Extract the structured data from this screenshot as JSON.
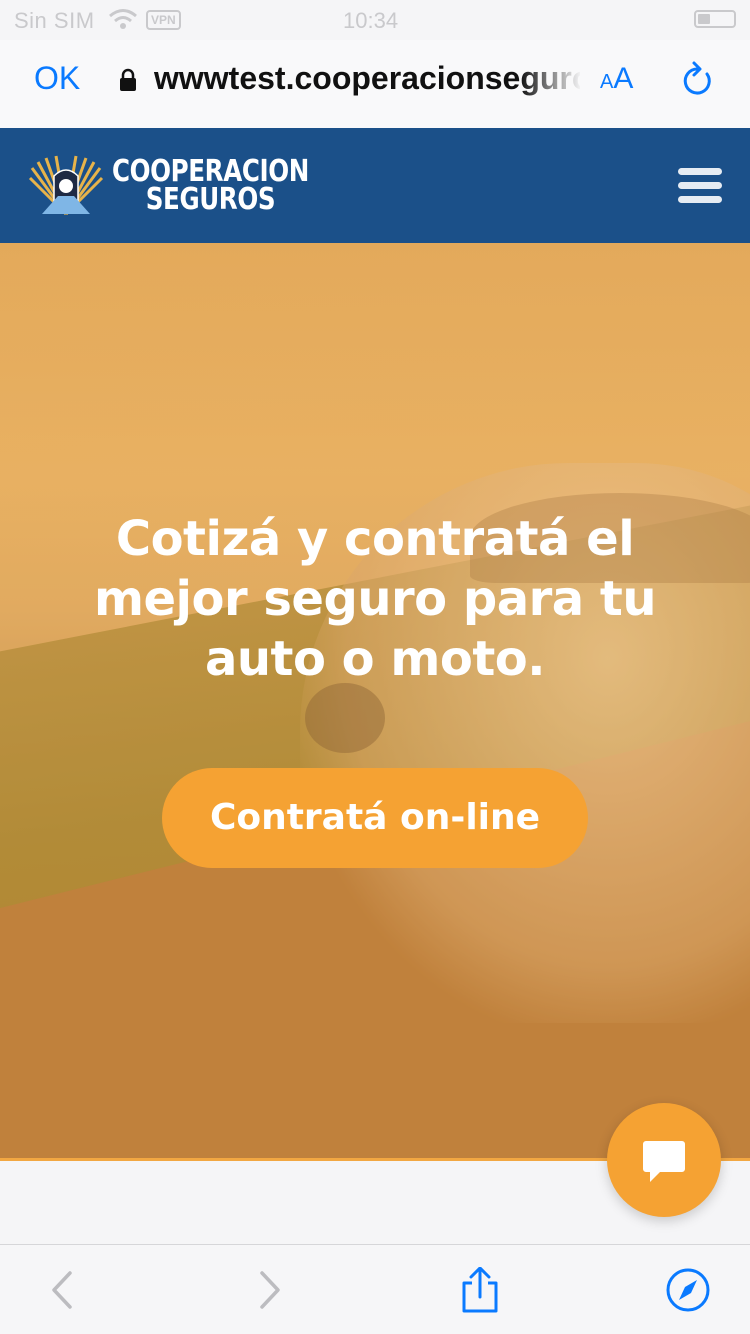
{
  "status_bar": {
    "carrier": "Sin SIM",
    "vpn": "VPN",
    "time": "10:34"
  },
  "browser": {
    "done_label": "OK",
    "url": "wwwtest.cooperacionseguros.com.ar",
    "text_size_small": "A",
    "text_size_large": "A"
  },
  "site": {
    "logo_line1": "COOPERACION",
    "logo_line2": "SEGUROS",
    "brand_color": "#1b5089",
    "accent_color": "#f5a233"
  },
  "hero": {
    "title": "Cotizá y contratá el mejor seguro para tu auto o moto.",
    "cta_label": "Contratá on-line"
  },
  "icons": {
    "chat": "chat-bubble-icon",
    "menu": "hamburger-menu-icon",
    "back": "chevron-left-icon",
    "forward": "chevron-right-icon",
    "share": "share-icon",
    "compass": "compass-icon"
  }
}
